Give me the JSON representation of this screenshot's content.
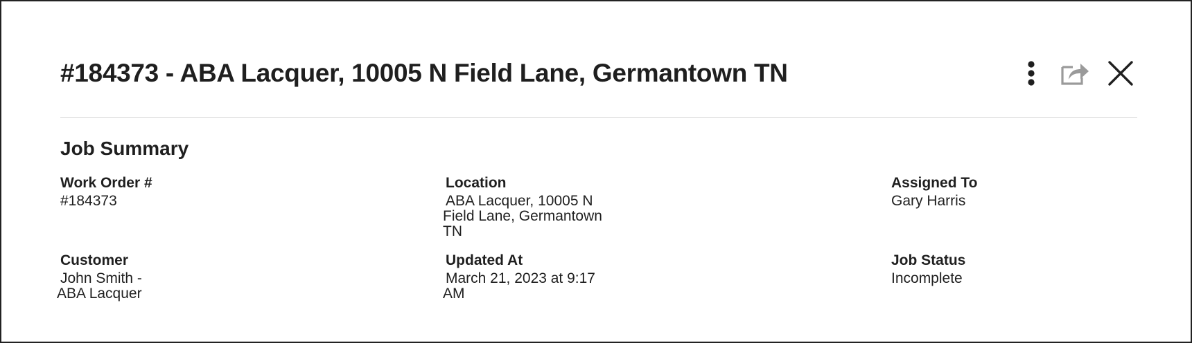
{
  "header": {
    "title": "#184373 - ABA Lacquer, 10005 N Field Lane, Germantown TN",
    "icons": [
      "more-vertical-icon",
      "share-icon",
      "close-icon"
    ]
  },
  "summary": {
    "section_title": "Job Summary",
    "work_order": {
      "label": "Work Order #",
      "value": "#184373"
    },
    "location": {
      "label": "Location",
      "value": "ABA Lacquer, 10005 N Field Lane, Germantown TN"
    },
    "assigned_to": {
      "label": "Assigned To",
      "value": "Gary Harris"
    },
    "customer": {
      "label": "Customer",
      "value": "John Smith - ABA Lacquer"
    },
    "updated_at": {
      "label": "Updated At",
      "value": "March 21, 2023 at 9:17 AM"
    },
    "job_status": {
      "label": "Job Status",
      "value": "Incomplete"
    }
  },
  "colors": {
    "text": "#1f1f1f",
    "divider": "#d6d6d6",
    "border": "#222222",
    "share_icon": "#9a9a9a"
  }
}
